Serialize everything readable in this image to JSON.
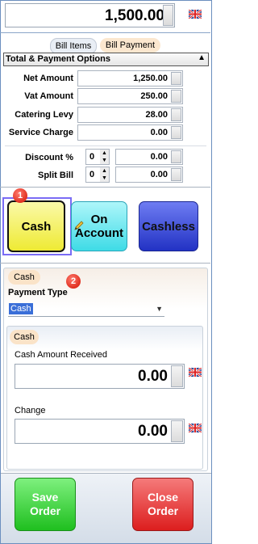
{
  "header": {
    "total": "1,500.00"
  },
  "tabs": [
    {
      "label": "Bill Items"
    },
    {
      "label": "Bill Payment"
    }
  ],
  "section": {
    "title": "Total & Payment Options",
    "collapse_glyph": "▲"
  },
  "summary": [
    {
      "label": "Net Amount",
      "value": "1,250.00"
    },
    {
      "label": "Vat Amount",
      "value": "250.00"
    },
    {
      "label": "Catering Levy",
      "value": "28.00"
    },
    {
      "label": "Service Charge",
      "value": "0.00"
    }
  ],
  "discount": {
    "label": "Discount %",
    "count": "0",
    "value": "0.00"
  },
  "split": {
    "label": "Split Bill",
    "count": "0",
    "value": "0.00"
  },
  "badges": [
    "1",
    "2"
  ],
  "payment_buttons": [
    {
      "label": "Cash",
      "color": "#f5f066"
    },
    {
      "label": "On Account",
      "color": "#5fe8f0"
    },
    {
      "label": "Cashless",
      "color": "#3446d6"
    }
  ],
  "payment": {
    "group_tab": "Cash",
    "type_label": "Payment Type",
    "type_value": "Cash",
    "sub_tab": "Cash",
    "received_label": "Cash Amount Received",
    "received_value": "0.00",
    "change_label": "Change",
    "change_value": "0.00"
  },
  "footer": {
    "save_label": "Save Order",
    "close_label": "Close Order"
  },
  "colors": {
    "accent_border": "#6b8fbf",
    "save_green": "#2ec82e",
    "close_red": "#e22e2e",
    "badge_red": "#e03020"
  }
}
